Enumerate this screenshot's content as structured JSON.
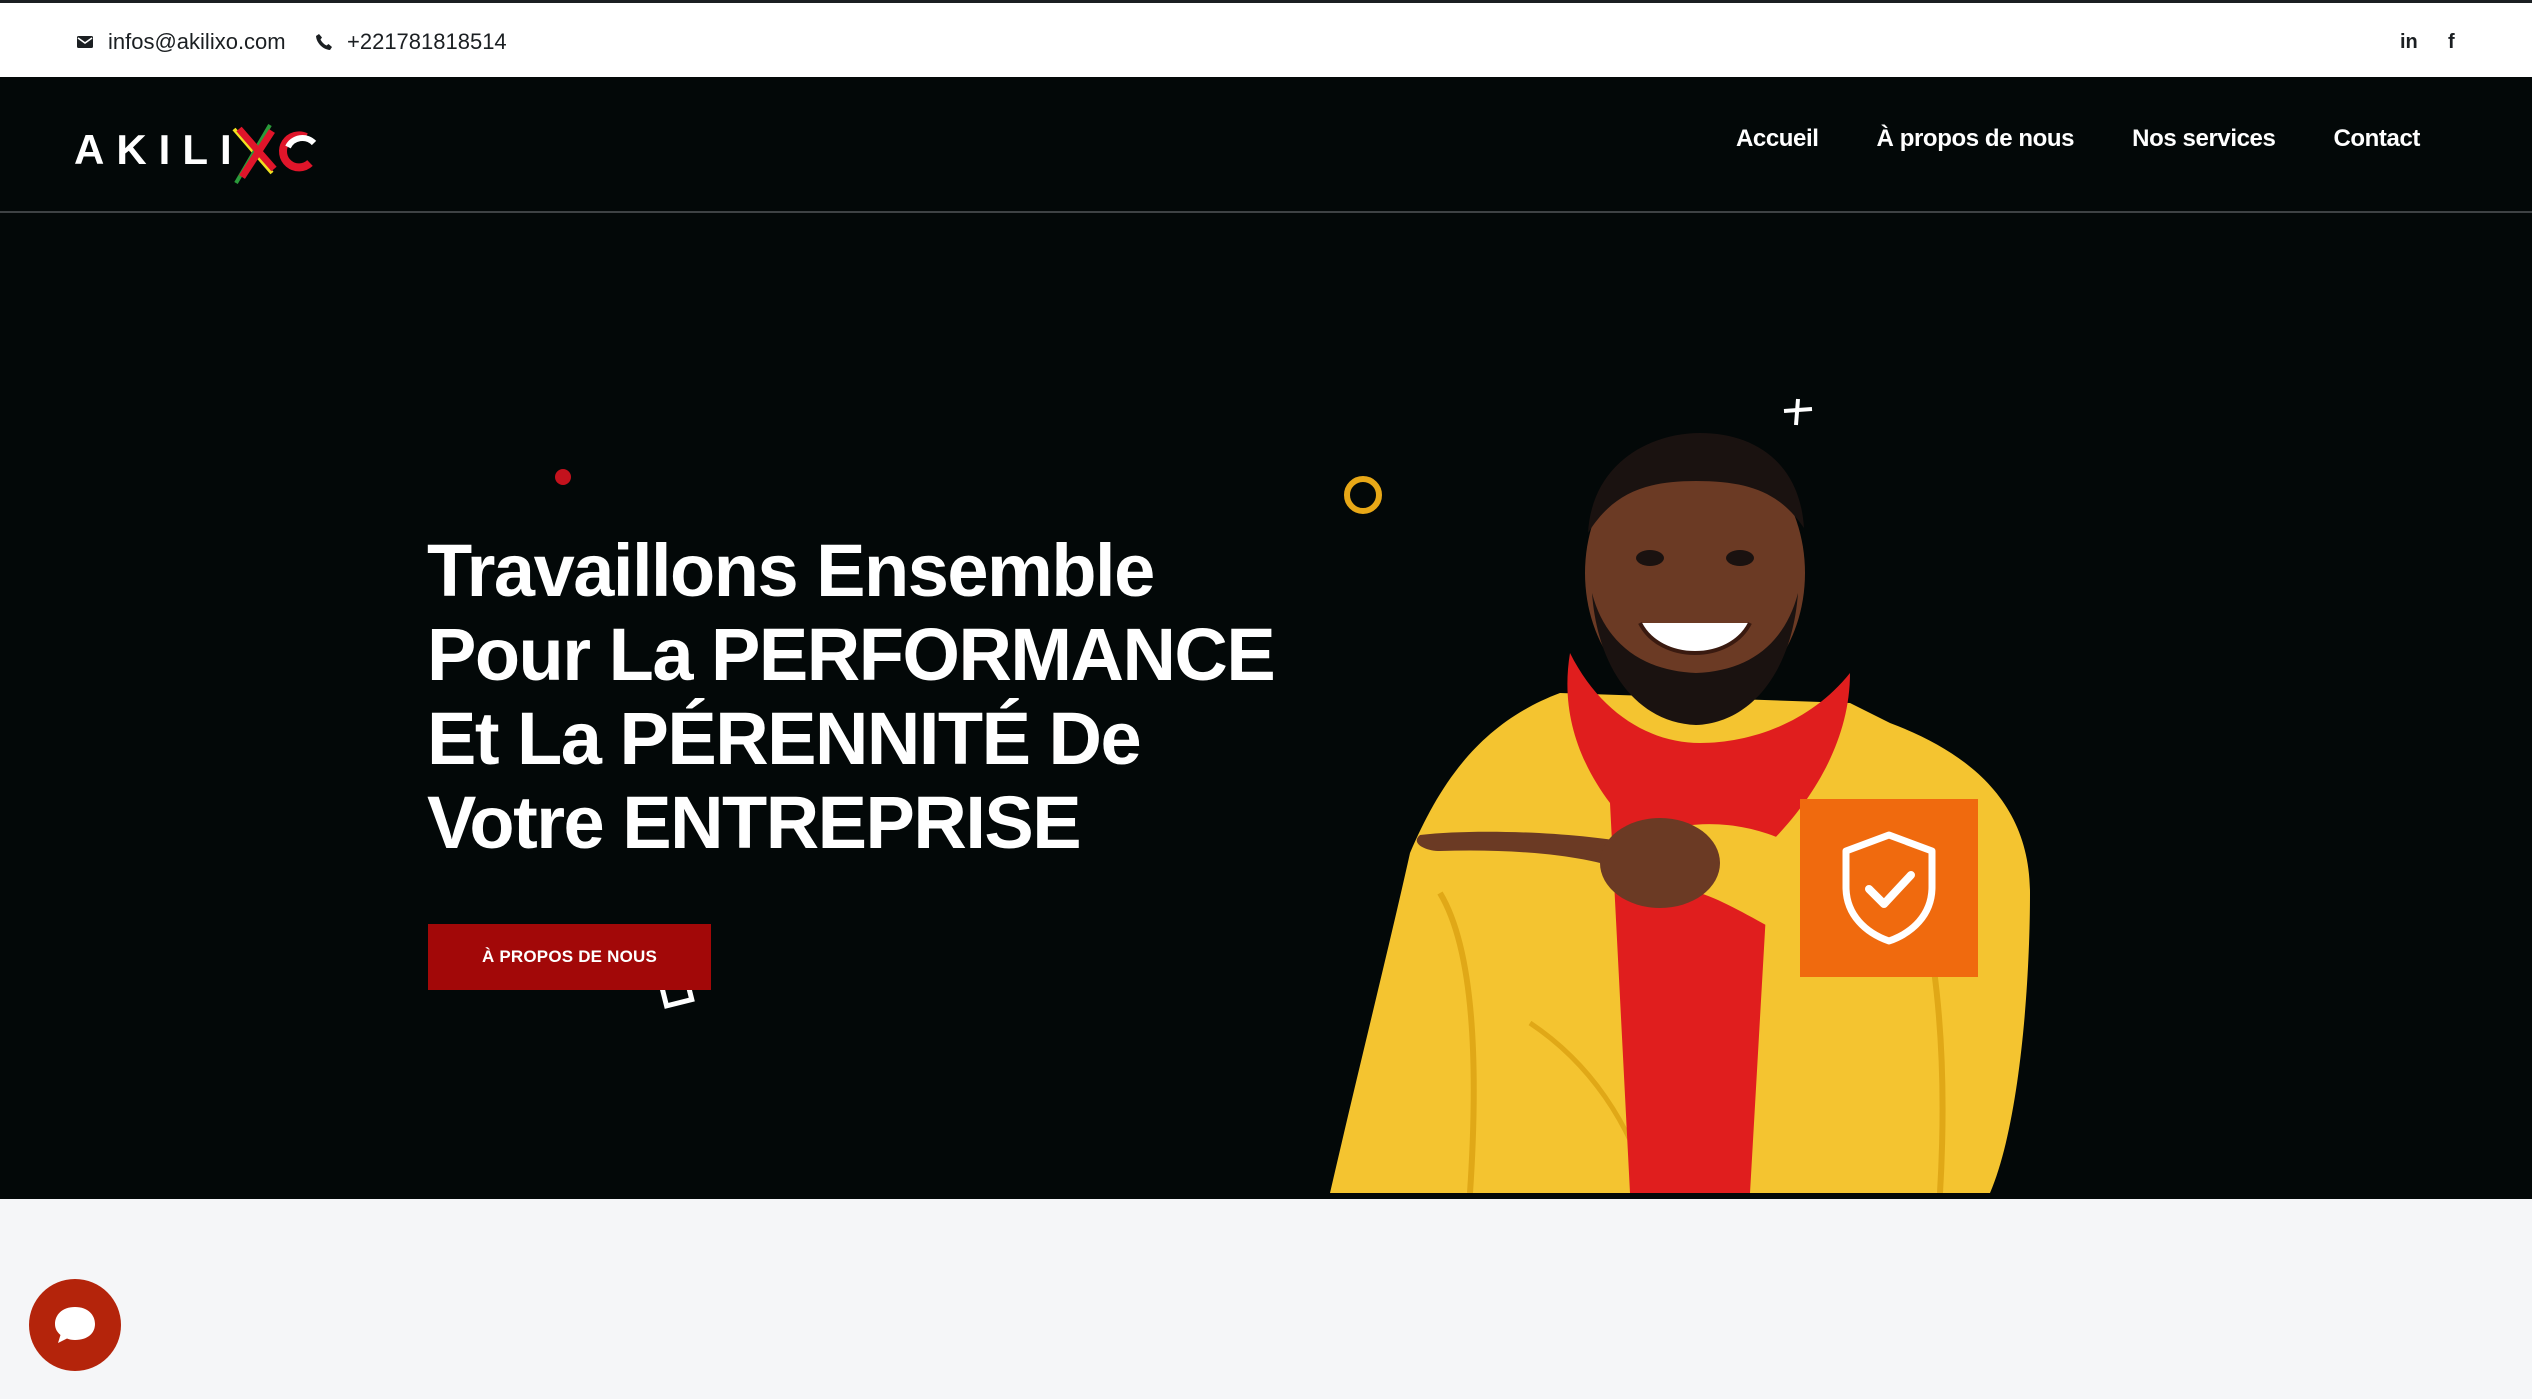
{
  "topbar": {
    "email": "infos@akilixo.com",
    "phone": "+221781818514",
    "linkedin_label": "in",
    "facebook_label": "f"
  },
  "logo": {
    "text": "AKILIXO"
  },
  "nav": {
    "items": [
      {
        "label": "Accueil"
      },
      {
        "label": "À propos de nous"
      },
      {
        "label": "Nos services"
      },
      {
        "label": "Contact"
      }
    ]
  },
  "hero": {
    "headline_lines": [
      "Travaillons Ensemble",
      "Pour La PERFORMANCE",
      "Et La PÉRENNITÉ De",
      "Votre ENTREPRISE"
    ],
    "cta_label": "À PROPOS DE NOUS"
  },
  "colors": {
    "dark_bg": "#030808",
    "cta_red": "#a20808",
    "accent_orange": "#f06a0e",
    "jacket_yellow": "#f4c430",
    "hoodie_red": "#e01e1e",
    "chat_red": "#b4240b"
  },
  "icons": [
    "email-icon",
    "phone-icon",
    "linkedin-icon",
    "facebook-icon",
    "shield-check-icon",
    "chat-bubble-icon",
    "plus-icon",
    "ring-icon"
  ]
}
